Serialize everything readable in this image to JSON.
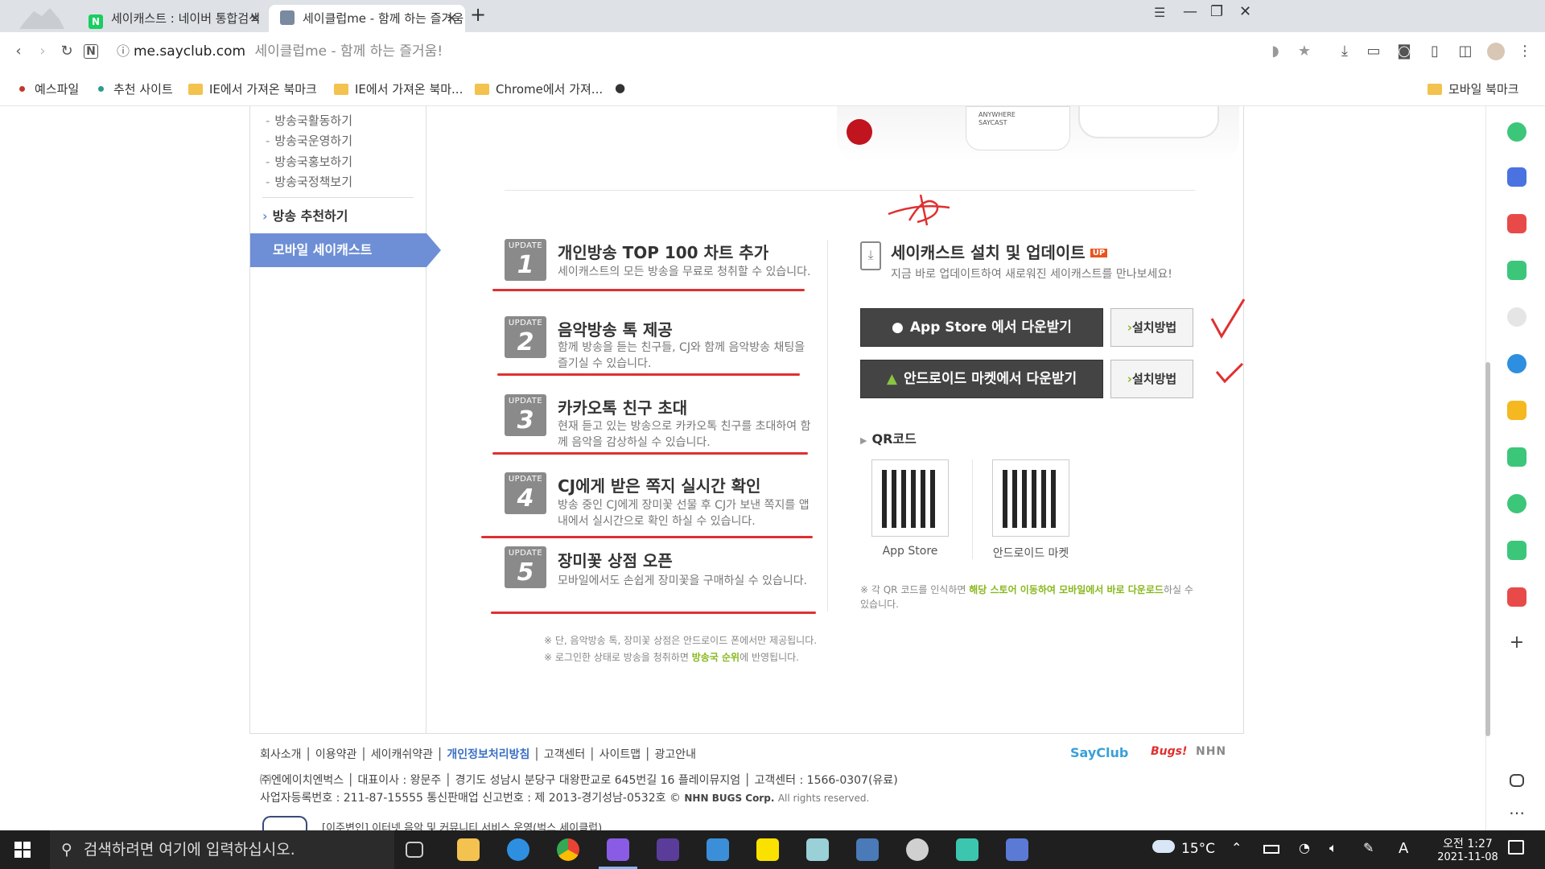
{
  "tabs": [
    {
      "title": "세이캐스트 : 네이버 통합검색",
      "favicon_color": "#19ce60",
      "favicon_letter": "N"
    },
    {
      "title": "세이클럽me - 함께 하는 즐거움",
      "favicon_color": "#7a8aa0",
      "favicon_letter": ""
    }
  ],
  "new_tab": "+",
  "address": {
    "domain": "me.sayclub.com",
    "page_title": "세이클럽me - 함께 하는 즐거움!"
  },
  "bookmarks": [
    {
      "label": "예스파일",
      "kind": "dot",
      "color": "#c0392b"
    },
    {
      "label": "추천 사이트",
      "kind": "dot",
      "color": "#2c9c8e"
    },
    {
      "label": "IE에서 가져온 북마크",
      "kind": "folder"
    },
    {
      "label": "IE에서 가져온 북마...",
      "kind": "folder"
    },
    {
      "label": "Chrome에서 가져...",
      "kind": "folder"
    }
  ],
  "mobile_bookmarks": "모바일 북마크",
  "leftnav": {
    "subitems": [
      "방송국활동하기",
      "방송국운영하기",
      "방송국홍보하기",
      "방송국정책보기"
    ],
    "recommend": "방송 추천하기",
    "active": "모바일 세이캐스트"
  },
  "hero_text": "ANYWHERE SAYCAST",
  "updates": [
    {
      "label": "UPDATE",
      "num": "1",
      "title": "개인방송 TOP 100 차트 추가",
      "desc": "세이캐스트의 모든 방송을 무료로 청취할 수 있습니다."
    },
    {
      "label": "UPDATE",
      "num": "2",
      "title": "음악방송 톡 제공",
      "desc": "함께 방송을 듣는 친구들, CJ와 함께 음악방송 채팅을 즐기실 수 있습니다."
    },
    {
      "label": "UPDATE",
      "num": "3",
      "title": "카카오톡 친구 초대",
      "desc": "현재 듣고 있는 방송으로 카카오톡 친구를 초대하여 함께 음악을 감상하실 수 있습니다."
    },
    {
      "label": "UPDATE",
      "num": "4",
      "title": "CJ에게 받은 쪽지 실시간 확인",
      "desc": "방송 중인 CJ에게 장미꽃 선물 후 CJ가 보낸 쪽지를 앱 내에서 실시간으로 확인 하실 수 있습니다."
    },
    {
      "label": "UPDATE",
      "num": "5",
      "title": "장미꽃 상점 오픈",
      "desc": "모바일에서도 손쉽게 장미꽃을 구매하실 수 있습니다."
    }
  ],
  "notes": [
    "※ 단, 음악방송 톡, 장미꽃 상점은 안드로이드 폰에서만 제공됩니다.",
    "※ 로그인한 상태로 방송을 청취하면 ",
    "방송국 순위",
    "에 반영됩니다."
  ],
  "install": {
    "title": "세이캐스트 설치 및 업데이트",
    "badge": "UP",
    "desc": "지금 바로 업데이트하여 새로워진 세이캐스트를 만나보세요!",
    "appstore_btn": "App Store 에서 다운받기",
    "android_btn": "안드로이드 마켓에서 다운받기",
    "how_btn": "설치방법"
  },
  "qr": {
    "heading": "QR코드",
    "appstore": "App Store",
    "android": "안드로이드 마켓",
    "note_pre": "※ 각 QR 코드를 인식하면 ",
    "note_hl": "해당 스토어 이동하여 모바일에서 바로 다운로드",
    "note_post": "하실 수 있습니다."
  },
  "footer": {
    "links": [
      "회사소개",
      "이용약관",
      "세이캐쉬약관",
      "개인정보처리방침",
      "고객센터",
      "사이트맵",
      "광고안내"
    ],
    "company": "㈜엔에이치엔벅스 │ 대표이사 : 왕문주 │ 경기도 성남시 분당구 대왕판교로 645번길 16 플레이뮤지엄 │ 고객센터 : 1566-0307(유료)",
    "reg": "사업자등록번호 : 211-87-15555 통신판매업 신고번호 : 제 2013-경기성남-0532호 ©",
    "copy_brand": "NHN BUGS Corp.",
    "copy_rest": "All rights reserved.",
    "partial": "[이주변인] 이터넷 음악 및 커뮤니티 서비스 운영(벅스 세이클럽)",
    "logos": [
      "SayClub",
      "Bugs!",
      "NHN"
    ]
  },
  "taskbar": {
    "search_placeholder": "검색하려면 여기에 입력하십시오.",
    "weather": "15°C",
    "lang": "A",
    "time": "오전 1:27",
    "date": "2021-11-08"
  },
  "colors": {
    "accent": "#6e8fd6",
    "green": "#88b81e",
    "annotation": "#e03030"
  }
}
